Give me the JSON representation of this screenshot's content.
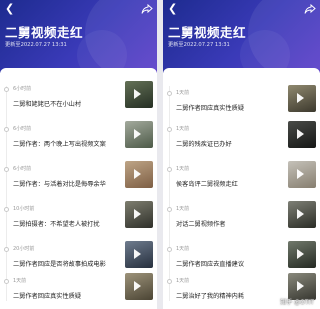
{
  "panels": [
    {
      "title": "二舅视频走红",
      "updated": "更新至2022.07.27 13:31",
      "items": [
        {
          "time": "6小时前",
          "text": "二舅和姥姥已不在小山村",
          "thumb": "#3b4a3a"
        },
        {
          "time": "6小时前",
          "text": "二舅作者：两个晚上写出视频文案",
          "thumb": "#6f7f6a"
        },
        {
          "time": "6小时前",
          "text": "二舅作者：与活着对比是侮辱余华",
          "thumb": "#caa27d"
        },
        {
          "time": "10小时前",
          "text": "二舅拍摄者：不希望老人被打扰",
          "thumb": "#5a5b52"
        },
        {
          "time": "20小时前",
          "text": "二舅作者回应是否将故事拍成电影",
          "thumb": "#4d5a6e"
        },
        {
          "time": "1天前",
          "text": "二舅作者回应真实性质疑",
          "thumb": "#8a8068"
        }
      ]
    },
    {
      "title": "二舅视频走红",
      "updated": "更新至2022.07.27 13:31",
      "items": [
        {
          "time": "1天前",
          "text": "二舅作者回应真实性质疑",
          "thumb": "#6b6656"
        },
        {
          "time": "1天前",
          "text": "二舅的残疾证已办好",
          "thumb": "#2c2e2b"
        },
        {
          "time": "1天前",
          "text": "侯客岛评二舅视频走红",
          "thumb": "#d9d2c4"
        },
        {
          "time": "1天前",
          "text": "对话二舅视频作者",
          "thumb": "#55584e"
        },
        {
          "time": "1天前",
          "text": "二舅作者回应去直播建议",
          "thumb": "#4a5148"
        },
        {
          "time": "1天前",
          "text": "二舅治好了我的精神内耗",
          "thumb": "#6a6a5e"
        }
      ]
    }
  ],
  "watermark": "知乎 @OTIT"
}
